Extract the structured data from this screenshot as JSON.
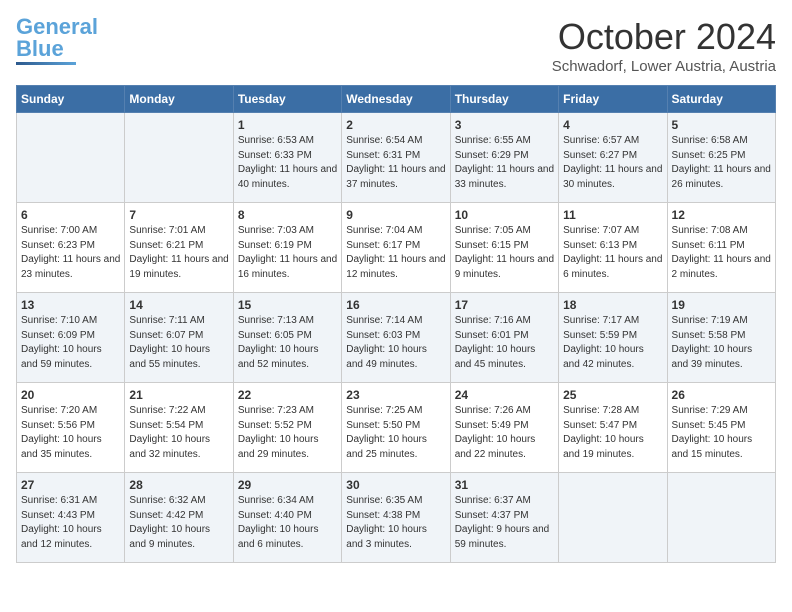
{
  "header": {
    "logo_general": "General",
    "logo_blue": "Blue",
    "month_title": "October 2024",
    "location": "Schwadorf, Lower Austria, Austria"
  },
  "weekdays": [
    "Sunday",
    "Monday",
    "Tuesday",
    "Wednesday",
    "Thursday",
    "Friday",
    "Saturday"
  ],
  "weeks": [
    [
      {
        "day": "",
        "info": ""
      },
      {
        "day": "",
        "info": ""
      },
      {
        "day": "1",
        "info": "Sunrise: 6:53 AM\nSunset: 6:33 PM\nDaylight: 11 hours\nand 40 minutes."
      },
      {
        "day": "2",
        "info": "Sunrise: 6:54 AM\nSunset: 6:31 PM\nDaylight: 11 hours\nand 37 minutes."
      },
      {
        "day": "3",
        "info": "Sunrise: 6:55 AM\nSunset: 6:29 PM\nDaylight: 11 hours\nand 33 minutes."
      },
      {
        "day": "4",
        "info": "Sunrise: 6:57 AM\nSunset: 6:27 PM\nDaylight: 11 hours\nand 30 minutes."
      },
      {
        "day": "5",
        "info": "Sunrise: 6:58 AM\nSunset: 6:25 PM\nDaylight: 11 hours\nand 26 minutes."
      }
    ],
    [
      {
        "day": "6",
        "info": "Sunrise: 7:00 AM\nSunset: 6:23 PM\nDaylight: 11 hours\nand 23 minutes."
      },
      {
        "day": "7",
        "info": "Sunrise: 7:01 AM\nSunset: 6:21 PM\nDaylight: 11 hours\nand 19 minutes."
      },
      {
        "day": "8",
        "info": "Sunrise: 7:03 AM\nSunset: 6:19 PM\nDaylight: 11 hours\nand 16 minutes."
      },
      {
        "day": "9",
        "info": "Sunrise: 7:04 AM\nSunset: 6:17 PM\nDaylight: 11 hours\nand 12 minutes."
      },
      {
        "day": "10",
        "info": "Sunrise: 7:05 AM\nSunset: 6:15 PM\nDaylight: 11 hours\nand 9 minutes."
      },
      {
        "day": "11",
        "info": "Sunrise: 7:07 AM\nSunset: 6:13 PM\nDaylight: 11 hours\nand 6 minutes."
      },
      {
        "day": "12",
        "info": "Sunrise: 7:08 AM\nSunset: 6:11 PM\nDaylight: 11 hours\nand 2 minutes."
      }
    ],
    [
      {
        "day": "13",
        "info": "Sunrise: 7:10 AM\nSunset: 6:09 PM\nDaylight: 10 hours\nand 59 minutes."
      },
      {
        "day": "14",
        "info": "Sunrise: 7:11 AM\nSunset: 6:07 PM\nDaylight: 10 hours\nand 55 minutes."
      },
      {
        "day": "15",
        "info": "Sunrise: 7:13 AM\nSunset: 6:05 PM\nDaylight: 10 hours\nand 52 minutes."
      },
      {
        "day": "16",
        "info": "Sunrise: 7:14 AM\nSunset: 6:03 PM\nDaylight: 10 hours\nand 49 minutes."
      },
      {
        "day": "17",
        "info": "Sunrise: 7:16 AM\nSunset: 6:01 PM\nDaylight: 10 hours\nand 45 minutes."
      },
      {
        "day": "18",
        "info": "Sunrise: 7:17 AM\nSunset: 5:59 PM\nDaylight: 10 hours\nand 42 minutes."
      },
      {
        "day": "19",
        "info": "Sunrise: 7:19 AM\nSunset: 5:58 PM\nDaylight: 10 hours\nand 39 minutes."
      }
    ],
    [
      {
        "day": "20",
        "info": "Sunrise: 7:20 AM\nSunset: 5:56 PM\nDaylight: 10 hours\nand 35 minutes."
      },
      {
        "day": "21",
        "info": "Sunrise: 7:22 AM\nSunset: 5:54 PM\nDaylight: 10 hours\nand 32 minutes."
      },
      {
        "day": "22",
        "info": "Sunrise: 7:23 AM\nSunset: 5:52 PM\nDaylight: 10 hours\nand 29 minutes."
      },
      {
        "day": "23",
        "info": "Sunrise: 7:25 AM\nSunset: 5:50 PM\nDaylight: 10 hours\nand 25 minutes."
      },
      {
        "day": "24",
        "info": "Sunrise: 7:26 AM\nSunset: 5:49 PM\nDaylight: 10 hours\nand 22 minutes."
      },
      {
        "day": "25",
        "info": "Sunrise: 7:28 AM\nSunset: 5:47 PM\nDaylight: 10 hours\nand 19 minutes."
      },
      {
        "day": "26",
        "info": "Sunrise: 7:29 AM\nSunset: 5:45 PM\nDaylight: 10 hours\nand 15 minutes."
      }
    ],
    [
      {
        "day": "27",
        "info": "Sunrise: 6:31 AM\nSunset: 4:43 PM\nDaylight: 10 hours\nand 12 minutes."
      },
      {
        "day": "28",
        "info": "Sunrise: 6:32 AM\nSunset: 4:42 PM\nDaylight: 10 hours\nand 9 minutes."
      },
      {
        "day": "29",
        "info": "Sunrise: 6:34 AM\nSunset: 4:40 PM\nDaylight: 10 hours\nand 6 minutes."
      },
      {
        "day": "30",
        "info": "Sunrise: 6:35 AM\nSunset: 4:38 PM\nDaylight: 10 hours\nand 3 minutes."
      },
      {
        "day": "31",
        "info": "Sunrise: 6:37 AM\nSunset: 4:37 PM\nDaylight: 9 hours\nand 59 minutes."
      },
      {
        "day": "",
        "info": ""
      },
      {
        "day": "",
        "info": ""
      }
    ]
  ]
}
